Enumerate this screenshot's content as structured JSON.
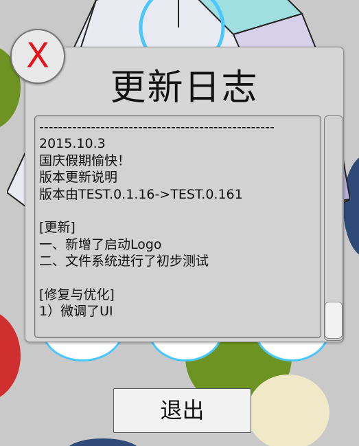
{
  "dialog": {
    "title": "更新日志",
    "log_text": "--------------------------------------------------\n2015.10.3\n国庆假期愉快！\n版本更新说明\n版本由TEST.0.1.16->TEST.0.161\n\n[更新]\n一、新增了启动Logo\n二、文件系统进行了初步测试\n\n[修复与优化]\n1）微调了UI"
  },
  "close_button": {
    "label": "X"
  },
  "exit_button": {
    "label": "退出"
  },
  "colors": {
    "background": "#c9c9c9",
    "close_x": "#e4141c",
    "green_circle": "#6d9422",
    "red_circle": "#cf2f2f",
    "navy_circle": "#2f4a76",
    "cyan_accent": "#49c7ff"
  }
}
